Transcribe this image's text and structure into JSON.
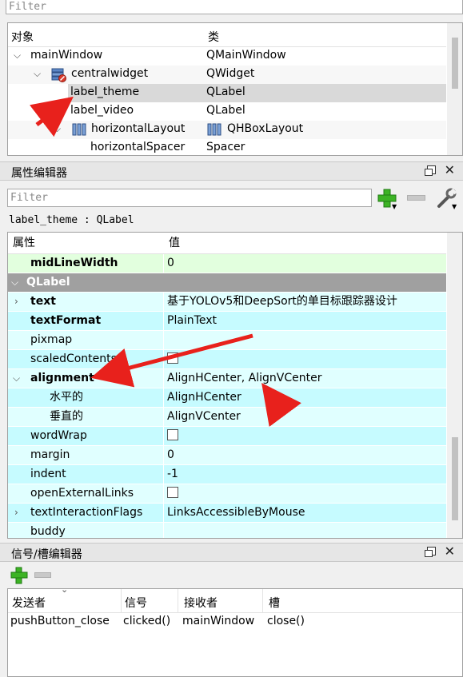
{
  "object_inspector": {
    "filter_placeholder": "Filter",
    "headers": {
      "object": "对象",
      "class": "类"
    },
    "rows": [
      {
        "object": "mainWindow",
        "class": "QMainWindow"
      },
      {
        "object": "centralwidget",
        "class": "QWidget"
      },
      {
        "object": "label_theme",
        "class": "QLabel"
      },
      {
        "object": "label_video",
        "class": "QLabel"
      },
      {
        "object": "horizontalLayout",
        "class": "QHBoxLayout"
      },
      {
        "object": "horizontalSpacer",
        "class": "Spacer"
      }
    ]
  },
  "property_editor": {
    "title": "属性编辑器",
    "filter_placeholder": "Filter",
    "object_line": "label_theme : QLabel",
    "headers": {
      "property": "属性",
      "value": "值"
    },
    "rows": [
      {
        "name": "midLineWidth",
        "value": "0"
      },
      {
        "name": "QLabel",
        "value": ""
      },
      {
        "name": "text",
        "value": "基于YOLOv5和DeepSort的单目标跟踪器设计"
      },
      {
        "name": "textFormat",
        "value": "PlainText"
      },
      {
        "name": "pixmap",
        "value": ""
      },
      {
        "name": "scaledContents",
        "value": ""
      },
      {
        "name": "alignment",
        "value": "AlignHCenter, AlignVCenter"
      },
      {
        "name": "水平的",
        "value": "AlignHCenter"
      },
      {
        "name": "垂直的",
        "value": "AlignVCenter"
      },
      {
        "name": "wordWrap",
        "value": ""
      },
      {
        "name": "margin",
        "value": "0"
      },
      {
        "name": "indent",
        "value": "-1"
      },
      {
        "name": "openExternalLinks",
        "value": ""
      },
      {
        "name": "textInteractionFlags",
        "value": "LinksAccessibleByMouse"
      },
      {
        "name": "buddy",
        "value": ""
      }
    ]
  },
  "signal_editor": {
    "title": "信号/槽编辑器",
    "headers": {
      "sender": "发送者",
      "signal": "信号",
      "receiver": "接收者",
      "slot": "槽"
    },
    "rows": [
      {
        "sender": "pushButton_close",
        "signal": "clicked()",
        "receiver": "mainWindow",
        "slot": "close()"
      }
    ]
  },
  "colors": {
    "arrow": "#e8211c",
    "group_header": "#a0a0a0",
    "cyan_row": "#e0ffff",
    "green_row": "#e2ffde",
    "plus_green": "#3cb324"
  },
  "icons": [
    "widget-icon",
    "layout-icon",
    "plus-icon",
    "minus-icon",
    "wrench-icon",
    "float-icon",
    "close-icon"
  ]
}
